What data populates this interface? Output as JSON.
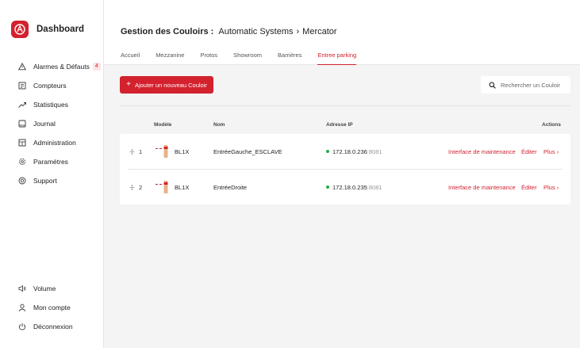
{
  "app": {
    "title": "Dashboard",
    "accent": "#d3212e"
  },
  "sidebar": {
    "top_items": [
      {
        "label": "Alarmes & Défauts",
        "icon": "alert-triangle-icon",
        "badge": "4"
      },
      {
        "label": "Compteurs",
        "icon": "counter-icon"
      },
      {
        "label": "Statistiques",
        "icon": "trend-up-icon"
      },
      {
        "label": "Journal",
        "icon": "journal-icon"
      },
      {
        "label": "Administration",
        "icon": "admin-icon"
      },
      {
        "label": "Paramètres",
        "icon": "gear-icon"
      },
      {
        "label": "Support",
        "icon": "support-icon"
      }
    ],
    "bottom_items": [
      {
        "label": "Volume",
        "icon": "volume-icon"
      },
      {
        "label": "Mon compte",
        "icon": "user-icon"
      },
      {
        "label": "Déconnexion",
        "icon": "power-icon"
      }
    ]
  },
  "header": {
    "title": "Gestion des Couloirs :",
    "crumbs": [
      "Automatic Systems",
      "Mercator"
    ],
    "separator": "›",
    "tabs": [
      "Accueil",
      "Mezzanine",
      "Protos",
      "Showroom",
      "Barrières",
      "Entree parking"
    ],
    "active_tab": "Entree parking"
  },
  "toolbar": {
    "add_label": "Ajouter un nouveau Couloir",
    "add_plus": "+",
    "search_placeholder": "Rechercher un Couloir"
  },
  "table": {
    "headers": {
      "model": "Modèle",
      "name": "Nom",
      "ip": "Adresse IP",
      "actions": "Actions"
    },
    "status_color": "#27a84a",
    "rows": [
      {
        "index": "1",
        "model": "BL1X",
        "name": "EntréeGauche_ESCLAVE",
        "ip": "172.18.0.236",
        "port": ":8081",
        "maintenance": "Interface de maintenance",
        "edit": "Éditer",
        "more": "Plus ›"
      },
      {
        "index": "2",
        "model": "BL1X",
        "name": "EntréeDroite",
        "ip": "172.18.0.235",
        "port": ":8081",
        "maintenance": "Interface de maintenance",
        "edit": "Éditer",
        "more": "Plus ›"
      }
    ]
  }
}
